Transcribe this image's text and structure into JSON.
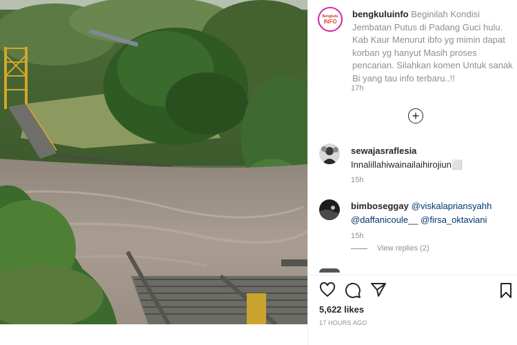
{
  "caption": {
    "username": "bengkuluinfo",
    "text": "Beginilah Kondisi Jembatan Putus di Padang Guci hulu. Kab Kaur Menurut ibfo yg mimin dapat korban yg hanyut Masih proses pencarian. Silahkan komen Untuk sanak Bi yang tau info terbaru..!!",
    "time": "17h",
    "avatar_text_top": "Bengkulu",
    "avatar_text_bottom": "INFO"
  },
  "load_more_icon": "plus-circle-icon",
  "comments": [
    {
      "username": "sewajasraflesia",
      "text": "Innalillahiwainailaihirojiun⬜",
      "time": "15h"
    },
    {
      "username": "bimboseggay",
      "mentions": [
        "@viskalapriansyahh",
        "@daffanicoule__",
        "@firsa_oktaviani"
      ],
      "time": "15h"
    }
  ],
  "view_replies": "View replies (2)",
  "actions": {
    "like_icon": "heart-icon",
    "comment_icon": "comment-bubble-icon",
    "share_icon": "paper-plane-icon",
    "save_icon": "bookmark-icon"
  },
  "likes": "5,622 likes",
  "post_time": "17 HOURS AGO",
  "colors": {
    "text": "#262626",
    "muted": "#8e8e8e",
    "mention": "#00376b",
    "brand_ring": "#d6249f"
  }
}
